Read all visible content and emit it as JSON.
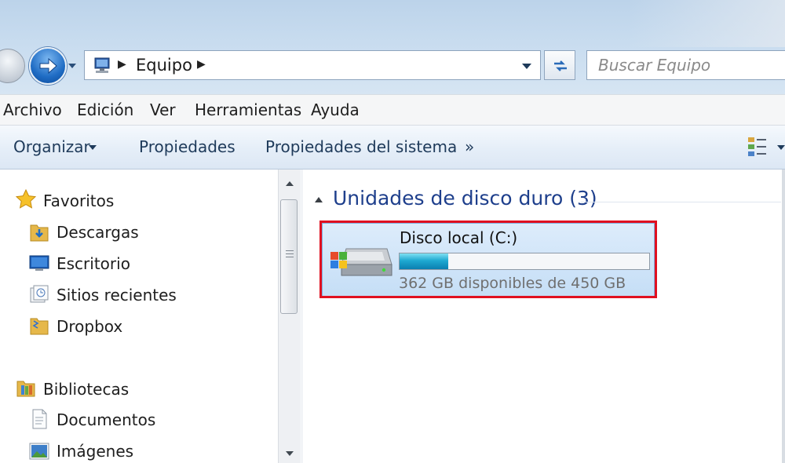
{
  "window": {
    "address_crumb": "Equipo",
    "search_placeholder": "Buscar Equipo"
  },
  "menu": [
    "Archivo",
    "Edición",
    "Ver",
    "Herramientas",
    "Ayuda"
  ],
  "toolbar": {
    "organize": "Organizar",
    "properties": "Propiedades",
    "system_properties": "Propiedades del sistema",
    "more": "»"
  },
  "navigation": {
    "favorites_header": "Favoritos",
    "favorites": [
      "Descargas",
      "Escritorio",
      "Sitios recientes",
      "Dropbox"
    ],
    "libraries_header": "Bibliotecas",
    "libraries": [
      "Documentos",
      "Imágenes"
    ]
  },
  "content": {
    "group_title": "Unidades de disco duro (3)",
    "drive": {
      "name": "Disco local (C:)",
      "free_text": "362 GB disponibles de 450 GB",
      "used_fraction": 0.196
    }
  },
  "colors": {
    "highlight": "#e01020",
    "group_title": "#1e3f8c",
    "usage_bar": "#1fa9d1"
  }
}
